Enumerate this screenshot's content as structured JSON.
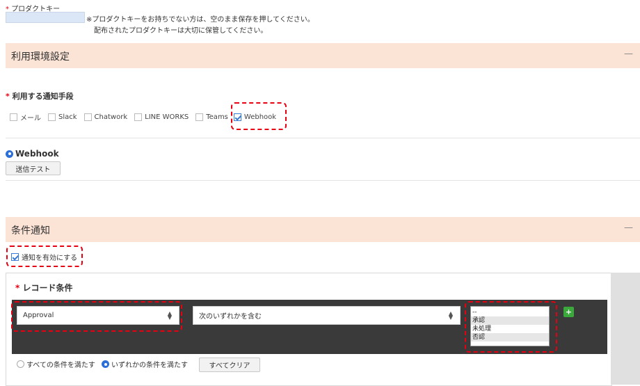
{
  "product_key": {
    "required_mark": "*",
    "label": "プロダクトキー",
    "value": "",
    "note_line1": "※プロダクトキーをお持ちでない方は、空のまま保存を押してください。",
    "note_line2": "配布されたプロダクトキーは大切に保管してください。"
  },
  "env_section": {
    "title": "利用環境設定",
    "collapse_symbol": "—",
    "notify_label": "利用する通知手段",
    "required_mark": "*",
    "methods": [
      {
        "label": "メール",
        "checked": false
      },
      {
        "label": "Slack",
        "checked": false
      },
      {
        "label": "Chatwork",
        "checked": false
      },
      {
        "label": "LINE WORKS",
        "checked": false
      },
      {
        "label": "Teams",
        "checked": false
      },
      {
        "label": "Webhook",
        "checked": true
      }
    ]
  },
  "webhook": {
    "title": "Webhook",
    "test_button": "送信テスト"
  },
  "condition_section": {
    "title": "条件通知",
    "collapse_symbol": "—",
    "enable_label": "通知を有効にする",
    "enable_checked": true,
    "record_condition_label": "レコード条件",
    "required_mark": "*",
    "field_select": "Approval",
    "operator_select": "次のいずれかを含む",
    "value_options": [
      "--",
      "承認",
      "未処理",
      "否認"
    ],
    "add_symbol": "+",
    "match_all_label": "すべての条件を満たす",
    "match_any_label": "いずれかの条件を満たす",
    "match_selected": "any",
    "clear_all_button": "すべてクリア"
  },
  "colors": {
    "section_bg": "#fbe3d6",
    "accent_red": "#e60012",
    "check_blue": "#3a7bd5",
    "dark_panel": "#3a3a3a",
    "add_green": "#3aa83a"
  }
}
